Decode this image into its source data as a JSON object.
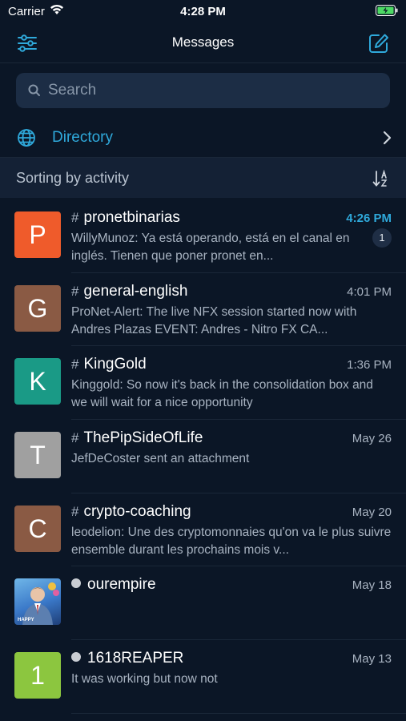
{
  "status_bar": {
    "carrier": "Carrier",
    "time": "4:28 PM"
  },
  "nav": {
    "title": "Messages",
    "left_icon": "filter-sliders-icon",
    "right_icon": "compose-icon"
  },
  "search": {
    "placeholder": "Search"
  },
  "directory": {
    "label": "Directory",
    "icon": "globe-icon"
  },
  "sorting": {
    "label": "Sorting by activity",
    "icon": "sort-alpha-icon"
  },
  "colors": {
    "accent": "#2fa9db",
    "background": "#0b1626",
    "search_bg": "#1c2d45"
  },
  "chats": [
    {
      "name": "pronetbinarias",
      "prefix": "#",
      "avatar_letter": "P",
      "avatar_color": "#ef5b2b",
      "time": "4:26 PM",
      "unread": "1",
      "preview": "WillyMunoz: Ya está operando, está en el canal en inglés. Tienen que poner pronet en..."
    },
    {
      "name": "general-english",
      "prefix": "#",
      "avatar_letter": "G",
      "avatar_color": "#8a5a44",
      "time": "4:01 PM",
      "preview": "ProNet-Alert: The live NFX session started now with Andres Plazas EVENT: Andres - Nitro FX CA..."
    },
    {
      "name": "KingGold",
      "prefix": "#",
      "avatar_letter": "K",
      "avatar_color": "#1a9a86",
      "time": "1:36 PM",
      "preview": "Kinggold: So now it's back in the consolidation box and we will wait for a nice opportunity"
    },
    {
      "name": "ThePipSideOfLife",
      "prefix": "#",
      "avatar_letter": "T",
      "avatar_color": "#a0a0a0",
      "time": "May 26",
      "preview": "JefDeCoster sent an attachment"
    },
    {
      "name": "crypto-coaching",
      "prefix": "#",
      "avatar_letter": "C",
      "avatar_color": "#8a5a44",
      "time": "May 20",
      "preview": "leodelion: Une des cryptomonnaies qu'on va le plus suivre ensemble durant les prochains mois v..."
    },
    {
      "name": "ourempire",
      "prefix": "dot",
      "avatar_letter": "",
      "avatar_color": "#3a78c8",
      "avatar_caption": "HAPPY",
      "time": "May 18",
      "preview": ""
    },
    {
      "name": "1618REAPER",
      "prefix": "dot",
      "avatar_letter": "1",
      "avatar_color": "#8cc63f",
      "time": "May 13",
      "preview": "It was working but now not"
    }
  ]
}
